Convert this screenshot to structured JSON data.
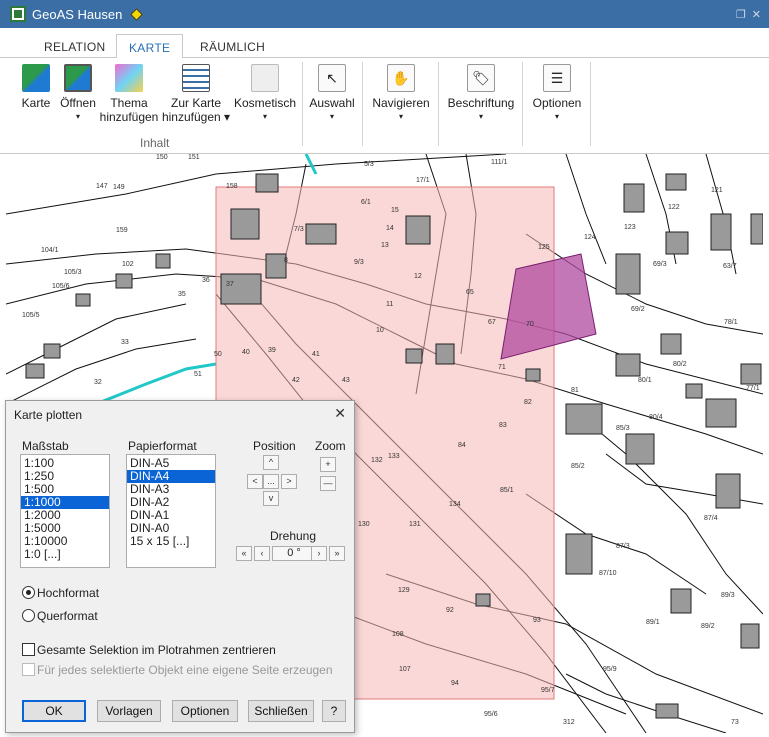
{
  "app": {
    "title": "GeoAS Hausen"
  },
  "tabs": [
    {
      "label": "RELATION"
    },
    {
      "label": "KARTE"
    },
    {
      "label": "RÄUMLICH"
    }
  ],
  "ribbon": {
    "karte": "Karte",
    "oeffnen": "Öffnen",
    "thema_1": "Thema",
    "thema_2": "hinzufügen",
    "zurkarte_1": "Zur Karte",
    "zurkarte_2": "hinzufügen",
    "kosmetisch": "Kosmetisch",
    "auswahl": "Auswahl",
    "navigieren": "Navigieren",
    "beschriftung": "Beschriftung",
    "optionen": "Optionen",
    "group_inhalt": "Inhalt"
  },
  "map": {
    "highlight_color": "#f7b8b8",
    "selected_color": "#b04a9e",
    "parcel_labels": [
      "150",
      "147",
      "149",
      "151",
      "5/3",
      "17/1",
      "111/1",
      "158",
      "6/1",
      "15",
      "14",
      "13",
      "7/3",
      "159",
      "8",
      "9/3",
      "12",
      "121",
      "104/1",
      "102",
      "105/3",
      "37",
      "36",
      "35",
      "65",
      "67",
      "70",
      "124",
      "123",
      "122",
      "125",
      "105/6",
      "105/5",
      "11",
      "10",
      "69/3",
      "63/7",
      "69/2",
      "78/1",
      "33",
      "39",
      "40",
      "41",
      "42",
      "43",
      "71",
      "80/2",
      "80/1",
      "81",
      "77/1",
      "32",
      "51",
      "50",
      "82",
      "83",
      "84",
      "85/3",
      "86/4",
      "80/4",
      "85/2",
      "87/4",
      "87/3",
      "87/10",
      "89/3",
      "89/1",
      "89/2",
      "95/9",
      "95/6",
      "312",
      "93",
      "92",
      "94",
      "95/7",
      "108",
      "107",
      "129",
      "131",
      "130",
      "134",
      "85/1",
      "133",
      "132",
      "73"
    ]
  },
  "dialog": {
    "title": "Karte plotten",
    "massstab_label": "Maßstab",
    "papierformat_label": "Papierformat",
    "position_label": "Position",
    "zoom_label": "Zoom",
    "drehung_label": "Drehung",
    "drehung_value": "0 °",
    "scales": [
      "1:100",
      "1:250",
      "1:500",
      "1:1000",
      "1:2000",
      "1:5000",
      "1:10000",
      "1:0 [...]"
    ],
    "selected_scale_index": 3,
    "formats": [
      "DIN-A5",
      "DIN-A4",
      "DIN-A3",
      "DIN-A2",
      "DIN-A1",
      "DIN-A0",
      "15 x 15 [...]"
    ],
    "selected_format_index": 1,
    "hochformat": "Hochformat",
    "querformat": "Querformat",
    "orientation": "Hochformat",
    "check_center": "Gesamte Selektion im Plotrahmen zentrieren",
    "check_pages": "Für jedes selektierte Objekt eine eigene Seite erzeugen",
    "buttons": {
      "ok": "OK",
      "vorlagen": "Vorlagen",
      "optionen": "Optionen",
      "schliessen": "Schließen",
      "help": "?"
    }
  }
}
